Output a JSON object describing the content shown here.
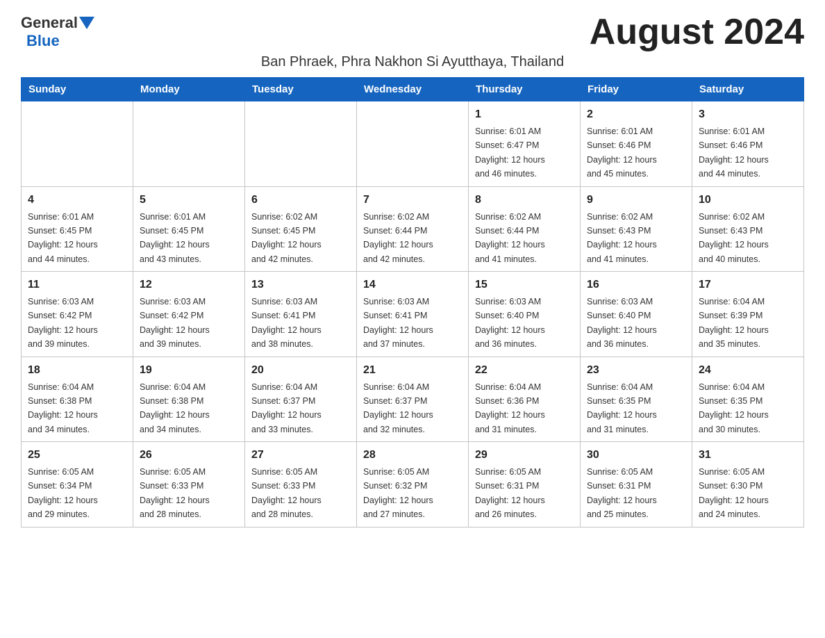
{
  "header": {
    "month_title": "August 2024",
    "location": "Ban Phraek, Phra Nakhon Si Ayutthaya, Thailand",
    "logo_general": "General",
    "logo_blue": "Blue"
  },
  "weekdays": [
    "Sunday",
    "Monday",
    "Tuesday",
    "Wednesday",
    "Thursday",
    "Friday",
    "Saturday"
  ],
  "weeks": [
    [
      {
        "day": "",
        "info": ""
      },
      {
        "day": "",
        "info": ""
      },
      {
        "day": "",
        "info": ""
      },
      {
        "day": "",
        "info": ""
      },
      {
        "day": "1",
        "info": "Sunrise: 6:01 AM\nSunset: 6:47 PM\nDaylight: 12 hours\nand 46 minutes."
      },
      {
        "day": "2",
        "info": "Sunrise: 6:01 AM\nSunset: 6:46 PM\nDaylight: 12 hours\nand 45 minutes."
      },
      {
        "day": "3",
        "info": "Sunrise: 6:01 AM\nSunset: 6:46 PM\nDaylight: 12 hours\nand 44 minutes."
      }
    ],
    [
      {
        "day": "4",
        "info": "Sunrise: 6:01 AM\nSunset: 6:45 PM\nDaylight: 12 hours\nand 44 minutes."
      },
      {
        "day": "5",
        "info": "Sunrise: 6:01 AM\nSunset: 6:45 PM\nDaylight: 12 hours\nand 43 minutes."
      },
      {
        "day": "6",
        "info": "Sunrise: 6:02 AM\nSunset: 6:45 PM\nDaylight: 12 hours\nand 42 minutes."
      },
      {
        "day": "7",
        "info": "Sunrise: 6:02 AM\nSunset: 6:44 PM\nDaylight: 12 hours\nand 42 minutes."
      },
      {
        "day": "8",
        "info": "Sunrise: 6:02 AM\nSunset: 6:44 PM\nDaylight: 12 hours\nand 41 minutes."
      },
      {
        "day": "9",
        "info": "Sunrise: 6:02 AM\nSunset: 6:43 PM\nDaylight: 12 hours\nand 41 minutes."
      },
      {
        "day": "10",
        "info": "Sunrise: 6:02 AM\nSunset: 6:43 PM\nDaylight: 12 hours\nand 40 minutes."
      }
    ],
    [
      {
        "day": "11",
        "info": "Sunrise: 6:03 AM\nSunset: 6:42 PM\nDaylight: 12 hours\nand 39 minutes."
      },
      {
        "day": "12",
        "info": "Sunrise: 6:03 AM\nSunset: 6:42 PM\nDaylight: 12 hours\nand 39 minutes."
      },
      {
        "day": "13",
        "info": "Sunrise: 6:03 AM\nSunset: 6:41 PM\nDaylight: 12 hours\nand 38 minutes."
      },
      {
        "day": "14",
        "info": "Sunrise: 6:03 AM\nSunset: 6:41 PM\nDaylight: 12 hours\nand 37 minutes."
      },
      {
        "day": "15",
        "info": "Sunrise: 6:03 AM\nSunset: 6:40 PM\nDaylight: 12 hours\nand 36 minutes."
      },
      {
        "day": "16",
        "info": "Sunrise: 6:03 AM\nSunset: 6:40 PM\nDaylight: 12 hours\nand 36 minutes."
      },
      {
        "day": "17",
        "info": "Sunrise: 6:04 AM\nSunset: 6:39 PM\nDaylight: 12 hours\nand 35 minutes."
      }
    ],
    [
      {
        "day": "18",
        "info": "Sunrise: 6:04 AM\nSunset: 6:38 PM\nDaylight: 12 hours\nand 34 minutes."
      },
      {
        "day": "19",
        "info": "Sunrise: 6:04 AM\nSunset: 6:38 PM\nDaylight: 12 hours\nand 34 minutes."
      },
      {
        "day": "20",
        "info": "Sunrise: 6:04 AM\nSunset: 6:37 PM\nDaylight: 12 hours\nand 33 minutes."
      },
      {
        "day": "21",
        "info": "Sunrise: 6:04 AM\nSunset: 6:37 PM\nDaylight: 12 hours\nand 32 minutes."
      },
      {
        "day": "22",
        "info": "Sunrise: 6:04 AM\nSunset: 6:36 PM\nDaylight: 12 hours\nand 31 minutes."
      },
      {
        "day": "23",
        "info": "Sunrise: 6:04 AM\nSunset: 6:35 PM\nDaylight: 12 hours\nand 31 minutes."
      },
      {
        "day": "24",
        "info": "Sunrise: 6:04 AM\nSunset: 6:35 PM\nDaylight: 12 hours\nand 30 minutes."
      }
    ],
    [
      {
        "day": "25",
        "info": "Sunrise: 6:05 AM\nSunset: 6:34 PM\nDaylight: 12 hours\nand 29 minutes."
      },
      {
        "day": "26",
        "info": "Sunrise: 6:05 AM\nSunset: 6:33 PM\nDaylight: 12 hours\nand 28 minutes."
      },
      {
        "day": "27",
        "info": "Sunrise: 6:05 AM\nSunset: 6:33 PM\nDaylight: 12 hours\nand 28 minutes."
      },
      {
        "day": "28",
        "info": "Sunrise: 6:05 AM\nSunset: 6:32 PM\nDaylight: 12 hours\nand 27 minutes."
      },
      {
        "day": "29",
        "info": "Sunrise: 6:05 AM\nSunset: 6:31 PM\nDaylight: 12 hours\nand 26 minutes."
      },
      {
        "day": "30",
        "info": "Sunrise: 6:05 AM\nSunset: 6:31 PM\nDaylight: 12 hours\nand 25 minutes."
      },
      {
        "day": "31",
        "info": "Sunrise: 6:05 AM\nSunset: 6:30 PM\nDaylight: 12 hours\nand 24 minutes."
      }
    ]
  ]
}
